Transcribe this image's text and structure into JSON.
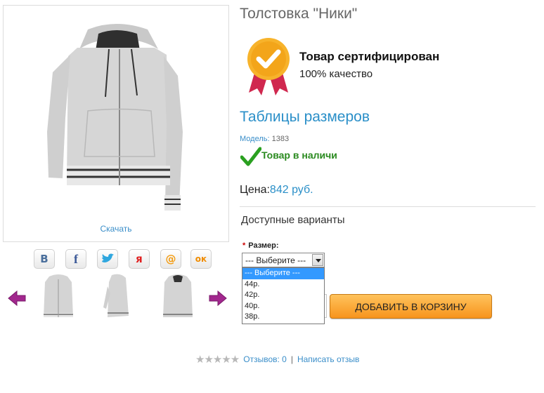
{
  "product": {
    "title": "Толстовка \"Ники\"",
    "download_label": "Скачать",
    "certified_title": "Товар сертифицирован",
    "certified_sub": "100% качество",
    "size_tables_link": "Таблицы размеров",
    "model_label": "Модель:",
    "model_value": "1383",
    "stock_status": "Товар в наличи",
    "price_label": "Цена:",
    "price_value": "842 руб.",
    "variants_title": "Доступные варианты",
    "size_label": "Размер:",
    "size_required_mark": "*",
    "size_selected": "--- Выберите ---",
    "size_options": [
      "--- Выберите ---",
      "44р.",
      "42р.",
      "40р.",
      "38р."
    ],
    "add_to_cart": "ДОБАВИТЬ В КОРЗИНУ"
  },
  "social": [
    {
      "name": "vk-icon",
      "glyph": "В",
      "color": "#4a6f9c"
    },
    {
      "name": "facebook-icon",
      "glyph": "f",
      "color": "#3b5998"
    },
    {
      "name": "twitter-icon",
      "glyph": "🐦",
      "color": "#2fa7df"
    },
    {
      "name": "yaru-icon",
      "glyph": "я",
      "color": "#e02020"
    },
    {
      "name": "mailru-icon",
      "glyph": "@",
      "color": "#f39c12"
    },
    {
      "name": "odnoklassniki-icon",
      "glyph": "ок",
      "color": "#f08c00"
    }
  ],
  "reviews": {
    "stars": "★★★★★",
    "count_label": "Отзывов: 0",
    "separator": "|",
    "write_label": "Написать отзыв"
  },
  "colors": {
    "link": "#2a8fc8",
    "stock": "#2a8a1f",
    "button": "#f7941d",
    "arrow": "#a2278e"
  }
}
